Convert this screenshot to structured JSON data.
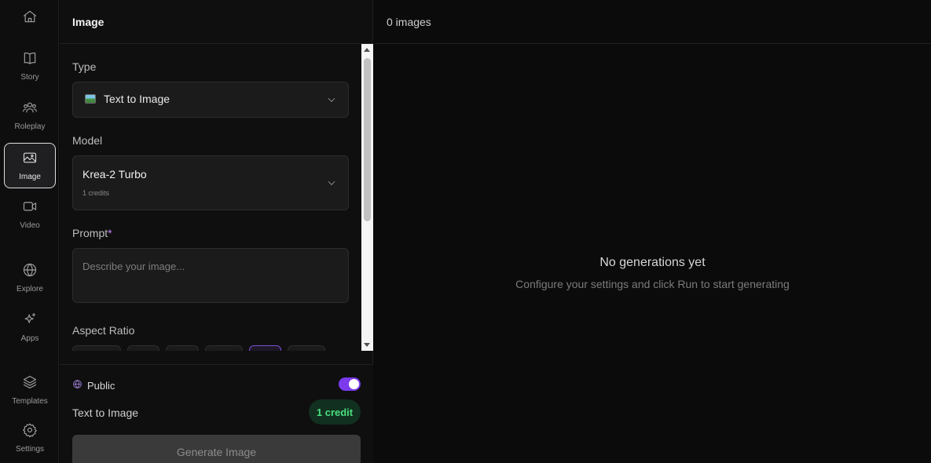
{
  "rail": {
    "items": [
      {
        "label": "",
        "icon": "home-icon"
      },
      {
        "label": "Story",
        "icon": "book-icon"
      },
      {
        "label": "Roleplay",
        "icon": "users-icon"
      },
      {
        "label": "Image",
        "icon": "image-icon",
        "active": true
      },
      {
        "label": "Video",
        "icon": "video-icon"
      },
      {
        "label": "Explore",
        "icon": "globe-icon"
      },
      {
        "label": "Apps",
        "icon": "sparkles-icon"
      },
      {
        "label": "Templates",
        "icon": "layers-icon"
      },
      {
        "label": "Settings",
        "icon": "gear-icon"
      }
    ]
  },
  "panel": {
    "title": "Image",
    "type": {
      "label": "Type",
      "value": "Text to Image"
    },
    "model": {
      "label": "Model",
      "name": "Krea-2 Turbo",
      "credits": "1 credits"
    },
    "prompt": {
      "label": "Prompt",
      "required_mark": "*",
      "placeholder": "Describe your image..."
    },
    "aspect_ratio": {
      "label": "Aspect Ratio"
    },
    "footer": {
      "public_label": "Public",
      "public_on": true,
      "mode": "Text to Image",
      "credit_badge": "1 credit",
      "generate_label": "Generate Image"
    }
  },
  "main": {
    "count": "0 images",
    "empty_title": "No generations yet",
    "empty_subtitle": "Configure your settings and click Run to start generating"
  },
  "colors": {
    "accent": "#7c3aed",
    "credit_green": "#4ade80",
    "background": "#0b0b0b"
  }
}
